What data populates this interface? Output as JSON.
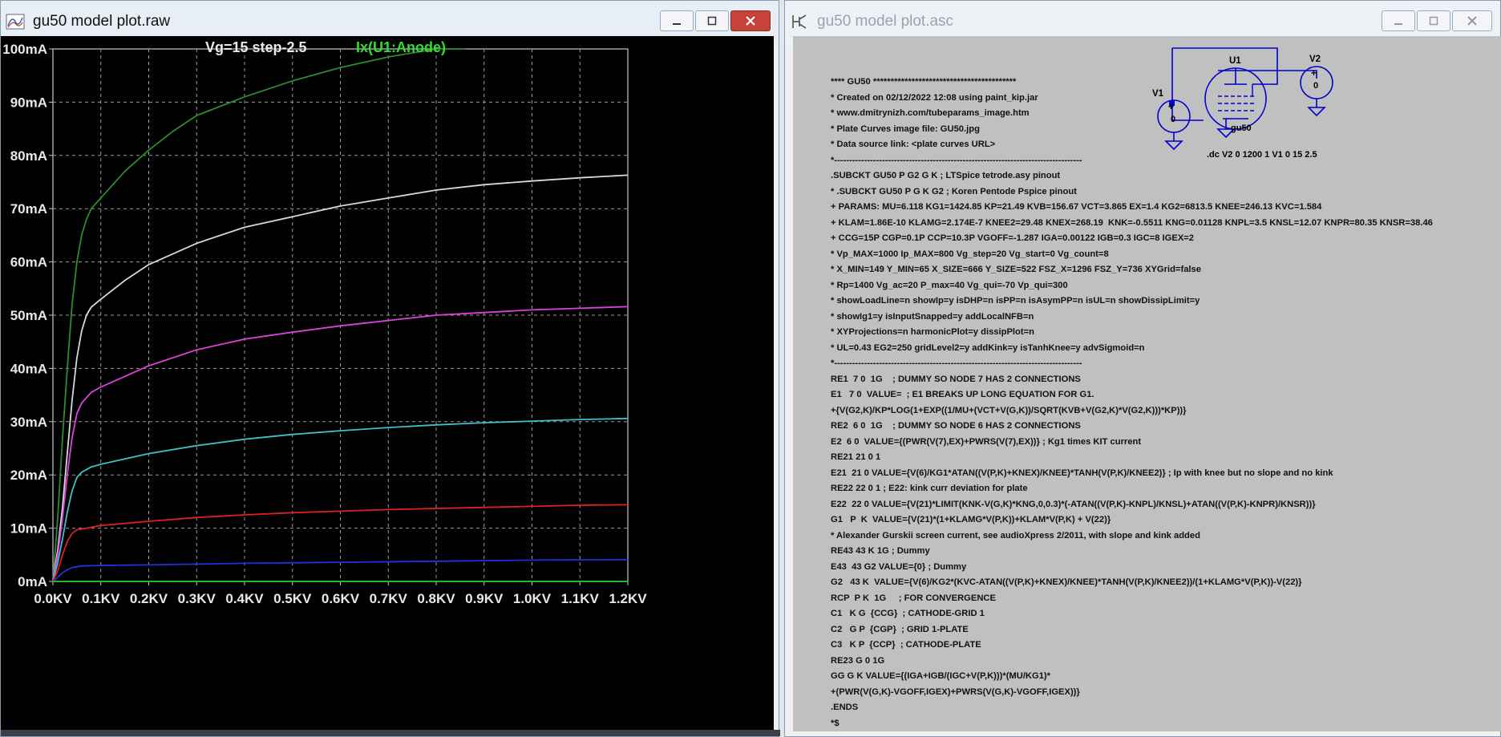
{
  "left_window": {
    "title": "gu50 model plot.raw",
    "plot_header": "Vg=15 step-2.5",
    "trace_label": "Ix(U1:Anode)",
    "trace_label_color": "#33dd33"
  },
  "right_window": {
    "title": "gu50 model plot.asc",
    "netlist_lines": [
      "**** GU50 *****************************************",
      "* Created on 02/12/2022 12:08 using paint_kip.jar",
      "* www.dmitrynizh.com/tubeparams_image.htm",
      "* Plate Curves image file: GU50.jpg",
      "* Data source link: <plate curves URL>",
      "*-----------------------------------------------------------------------------------",
      ".SUBCKT GU50 P G2 G K ; LTSpice tetrode.asy pinout",
      "* .SUBCKT GU50 P G K G2 ; Koren Pentode Pspice pinout",
      "+ PARAMS: MU=6.118 KG1=1424.85 KP=21.49 KVB=156.67 VCT=3.865 EX=1.4 KG2=6813.5 KNEE=246.13 KVC=1.584",
      "+ KLAM=1.86E-10 KLAMG=2.174E-7 KNEE2=29.48 KNEX=268.19  KNK=-0.5511 KNG=0.01128 KNPL=3.5 KNSL=12.07 KNPR=80.35 KNSR=38.46",
      "+ CCG=15P CGP=0.1P CCP=10.3P VGOFF=-1.287 IGA=0.00122 IGB=0.3 IGC=8 IGEX=2",
      "* Vp_MAX=1000 Ip_MAX=800 Vg_step=20 Vg_start=0 Vg_count=8",
      "* X_MIN=149 Y_MIN=65 X_SIZE=666 Y_SIZE=522 FSZ_X=1296 FSZ_Y=736 XYGrid=false",
      "* Rp=1400 Vg_ac=20 P_max=40 Vg_qui=-70 Vp_qui=300",
      "* showLoadLine=n showIp=y isDHP=n isPP=n isAsymPP=n isUL=n showDissipLimit=y",
      "* showIg1=y isInputSnapped=y addLocalNFB=n",
      "* XYProjections=n harmonicPlot=y dissipPlot=n",
      "* UL=0.43 EG2=250 gridLevel2=y addKink=y isTanhKnee=y advSigmoid=n",
      "*-----------------------------------------------------------------------------------",
      "RE1  7 0  1G    ; DUMMY SO NODE 7 HAS 2 CONNECTIONS",
      "E1   7 0  VALUE=  ; E1 BREAKS UP LONG EQUATION FOR G1.",
      "+{V(G2,K)/KP*LOG(1+EXP((1/MU+(VCT+V(G,K))/SQRT(KVB+V(G2,K)*V(G2,K)))*KP))}",
      "RE2  6 0  1G    ; DUMMY SO NODE 6 HAS 2 CONNECTIONS",
      "E2  6 0  VALUE={(PWR(V(7),EX)+PWRS(V(7),EX))} ; Kg1 times KIT current",
      "RE21 21 0 1",
      "E21  21 0 VALUE={V(6)/KG1*ATAN((V(P,K)+KNEX)/KNEE)*TANH(V(P,K)/KNEE2)} ; Ip with knee but no slope and no kink",
      "RE22 22 0 1 ; E22: kink curr deviation for plate",
      "E22  22 0 VALUE={V(21)*LIMIT(KNK-V(G,K)*KNG,0,0.3)*(-ATAN((V(P,K)-KNPL)/KNSL)+ATAN((V(P,K)-KNPR)/KNSR))}",
      "G1   P  K  VALUE={V(21)*(1+KLAMG*V(P,K))+KLAM*V(P,K) + V(22)}",
      "* Alexander Gurskii screen current, see audioXpress 2/2011, with slope and kink added",
      "RE43 43 K 1G ; Dummy",
      "E43  43 G2 VALUE={0} ; Dummy",
      "G2   43 K  VALUE={V(6)/KG2*(KVC-ATAN((V(P,K)+KNEX)/KNEE)*TANH(V(P,K)/KNEE2))/(1+KLAMG*V(P,K))-V(22)}",
      "RCP  P K  1G     ; FOR CONVERGENCE",
      "C1   K G  {CCG}  ; CATHODE-GRID 1",
      "C2   G P  {CGP}  ; GRID 1-PLATE",
      "C3   K P  {CCP}  ; CATHODE-PLATE",
      "RE23 G 0 1G",
      "GG G K VALUE={(IGA+IGB/(IGC+V(P,K)))*(MU/KG1)*",
      "+(PWR(V(G,K)-VGOFF,IGEX)+PWRS(V(G,K)-VGOFF,IGEX))}",
      ".ENDS",
      "*$"
    ],
    "schematic": {
      "u1_label": "U1",
      "u1_value": "gu50",
      "v1_label": "V1",
      "v1_value": "0",
      "v2_label": "V2",
      "v2_value": "0",
      "dc_directive": ".dc V2 0 1200 1 V1 0 15 2.5"
    }
  },
  "chart_data": {
    "type": "line",
    "title": "",
    "xlabel": "",
    "ylabel": "",
    "xlim": [
      0,
      1200
    ],
    "ylim": [
      0,
      100
    ],
    "x_unit": "V",
    "y_unit": "mA",
    "x_ticks": [
      "0.0KV",
      "0.1KV",
      "0.2KV",
      "0.3KV",
      "0.4KV",
      "0.5KV",
      "0.6KV",
      "0.7KV",
      "0.8KV",
      "0.9KV",
      "1.0KV",
      "1.1KV",
      "1.2KV"
    ],
    "y_ticks": [
      "0mA",
      "10mA",
      "20mA",
      "30mA",
      "40mA",
      "50mA",
      "60mA",
      "70mA",
      "80mA",
      "90mA",
      "100mA"
    ],
    "grid": true,
    "series": [
      {
        "color": "#2e8b2e",
        "points": [
          [
            0,
            0
          ],
          [
            10,
            12
          ],
          [
            20,
            27
          ],
          [
            30,
            40
          ],
          [
            40,
            52
          ],
          [
            50,
            60
          ],
          [
            60,
            65
          ],
          [
            70,
            68
          ],
          [
            80,
            70
          ],
          [
            100,
            72
          ],
          [
            150,
            77
          ],
          [
            200,
            81
          ],
          [
            250,
            84.5
          ],
          [
            300,
            87.5
          ],
          [
            400,
            91
          ],
          [
            500,
            94
          ],
          [
            600,
            96.5
          ],
          [
            700,
            98.5
          ],
          [
            800,
            100
          ],
          [
            860,
            100
          ]
        ]
      },
      {
        "color": "#d8d8d8",
        "points": [
          [
            0,
            0
          ],
          [
            10,
            6
          ],
          [
            20,
            14
          ],
          [
            30,
            24
          ],
          [
            40,
            34
          ],
          [
            50,
            42
          ],
          [
            60,
            47
          ],
          [
            70,
            50
          ],
          [
            80,
            51.5
          ],
          [
            100,
            53
          ],
          [
            150,
            56.5
          ],
          [
            200,
            59.5
          ],
          [
            300,
            63.5
          ],
          [
            400,
            66.5
          ],
          [
            500,
            68.5
          ],
          [
            600,
            70.5
          ],
          [
            700,
            72
          ],
          [
            800,
            73.5
          ],
          [
            900,
            74.5
          ],
          [
            1000,
            75.2
          ],
          [
            1100,
            75.8
          ],
          [
            1200,
            76.3
          ]
        ]
      },
      {
        "color": "#e040e0",
        "points": [
          [
            0,
            0
          ],
          [
            10,
            5
          ],
          [
            20,
            12
          ],
          [
            30,
            20
          ],
          [
            40,
            27
          ],
          [
            50,
            31.5
          ],
          [
            60,
            33.5
          ],
          [
            70,
            34.5
          ],
          [
            80,
            35.5
          ],
          [
            100,
            36.5
          ],
          [
            150,
            38.5
          ],
          [
            200,
            40.5
          ],
          [
            300,
            43.5
          ],
          [
            400,
            45.5
          ],
          [
            500,
            46.8
          ],
          [
            600,
            48
          ],
          [
            700,
            49
          ],
          [
            800,
            50
          ],
          [
            900,
            50.5
          ],
          [
            1000,
            51
          ],
          [
            1100,
            51.3
          ],
          [
            1200,
            51.6
          ]
        ]
      },
      {
        "color": "#40c0c8",
        "points": [
          [
            0,
            0
          ],
          [
            10,
            3.5
          ],
          [
            20,
            8
          ],
          [
            30,
            13
          ],
          [
            40,
            17
          ],
          [
            50,
            19.5
          ],
          [
            60,
            20.5
          ],
          [
            80,
            21.5
          ],
          [
            100,
            22
          ],
          [
            150,
            23
          ],
          [
            200,
            24
          ],
          [
            300,
            25.5
          ],
          [
            400,
            26.7
          ],
          [
            500,
            27.6
          ],
          [
            600,
            28.3
          ],
          [
            700,
            28.9
          ],
          [
            800,
            29.4
          ],
          [
            900,
            29.8
          ],
          [
            1000,
            30.1
          ],
          [
            1100,
            30.4
          ],
          [
            1200,
            30.6
          ]
        ]
      },
      {
        "color": "#e02020",
        "points": [
          [
            0,
            0
          ],
          [
            10,
            2
          ],
          [
            20,
            5
          ],
          [
            30,
            7.5
          ],
          [
            40,
            9
          ],
          [
            50,
            9.7
          ],
          [
            70,
            10
          ],
          [
            100,
            10.5
          ],
          [
            200,
            11.3
          ],
          [
            300,
            12
          ],
          [
            400,
            12.5
          ],
          [
            500,
            12.9
          ],
          [
            600,
            13.2
          ],
          [
            700,
            13.5
          ],
          [
            800,
            13.7
          ],
          [
            900,
            13.9
          ],
          [
            1000,
            14.1
          ],
          [
            1100,
            14.3
          ],
          [
            1200,
            14.4
          ]
        ]
      },
      {
        "color": "#2030e0",
        "points": [
          [
            0,
            0
          ],
          [
            10,
            0.8
          ],
          [
            20,
            1.6
          ],
          [
            30,
            2.2
          ],
          [
            40,
            2.6
          ],
          [
            60,
            2.9
          ],
          [
            100,
            3
          ],
          [
            200,
            3.1
          ],
          [
            400,
            3.4
          ],
          [
            600,
            3.6
          ],
          [
            800,
            3.8
          ],
          [
            1000,
            4
          ],
          [
            1200,
            4.1
          ]
        ]
      },
      {
        "color": "#22cc22",
        "points": [
          [
            0,
            0
          ],
          [
            1200,
            0
          ]
        ]
      }
    ]
  }
}
